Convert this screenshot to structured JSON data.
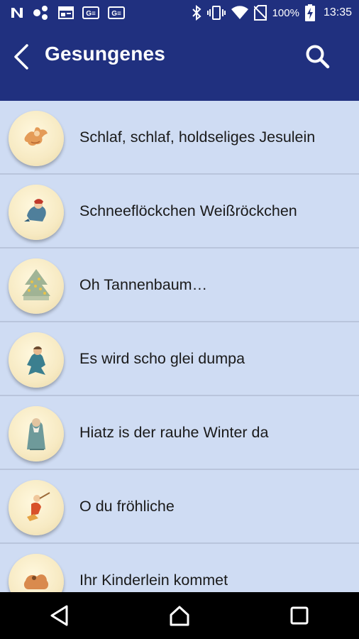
{
  "status_bar": {
    "left_icons": [
      "n-icon",
      "nodes-icon",
      "calendar-icon",
      "ge-card-icon",
      "ge-card-icon"
    ],
    "battery_percent": "100%",
    "time": "13:35"
  },
  "app_bar": {
    "title": "Gesungenes",
    "color": "#20307f"
  },
  "list": {
    "background": "#cfdcf3",
    "items": [
      {
        "title": "Schlaf, schlaf, holdseliges Jesulein",
        "icon": "angel-illustration"
      },
      {
        "title": "Schneeflöckchen Weißröckchen",
        "icon": "snow-child-illustration"
      },
      {
        "title": "Oh Tannenbaum…",
        "icon": "christmas-tree-illustration"
      },
      {
        "title": "Es wird scho glei dumpa",
        "icon": "shepherd-illustration"
      },
      {
        "title": "Hiatz is der rauhe Winter da",
        "icon": "old-man-illustration"
      },
      {
        "title": "O du fröhliche",
        "icon": "flute-player-illustration"
      },
      {
        "title": "Ihr Kinderlein kommet",
        "icon": "lamb-illustration"
      }
    ]
  },
  "nav_bar": {
    "buttons": [
      "back",
      "home",
      "recents"
    ]
  }
}
